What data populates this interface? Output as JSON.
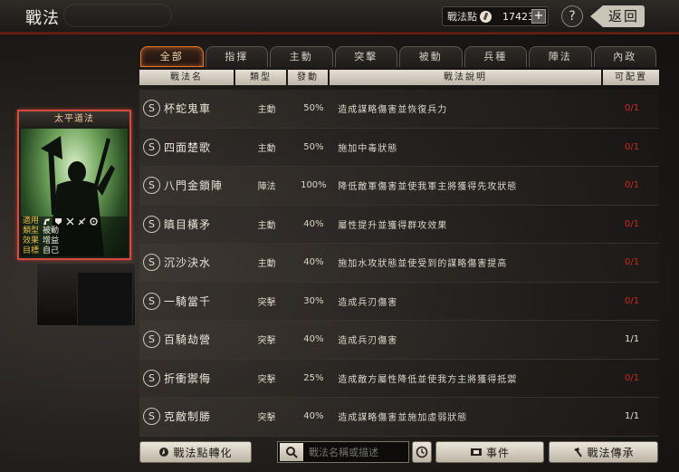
{
  "header": {
    "title": "戰法",
    "points_label": "戰法點",
    "points_value": "17423",
    "plus": "+",
    "help": "?",
    "back": "返回"
  },
  "tabs": [
    {
      "label": "全部",
      "active": true
    },
    {
      "label": "指揮",
      "active": false
    },
    {
      "label": "主動",
      "active": false
    },
    {
      "label": "突擊",
      "active": false
    },
    {
      "label": "被動",
      "active": false
    },
    {
      "label": "兵種",
      "active": false
    },
    {
      "label": "陣法",
      "active": false
    },
    {
      "label": "內政",
      "active": false
    }
  ],
  "table": {
    "headers": {
      "name": "戰法名",
      "type": "類型",
      "rate": "發動",
      "desc": "戰法說明",
      "cfg": "可配置"
    },
    "rows": [
      {
        "badge": "S",
        "name": "杯蛇鬼車",
        "type": "主動",
        "rate": "50%",
        "desc": "造成謀略傷害並恢復兵力",
        "cfg": "0/1",
        "cfg_color": "red"
      },
      {
        "badge": "S",
        "name": "四面楚歌",
        "type": "主動",
        "rate": "50%",
        "desc": "施加中毒狀態",
        "cfg": "0/1",
        "cfg_color": "red"
      },
      {
        "badge": "S",
        "name": "八門金鎖陣",
        "type": "陣法",
        "rate": "100%",
        "desc": "降低敵軍傷害並使我軍主將獲得先攻狀態",
        "cfg": "0/1",
        "cfg_color": "red"
      },
      {
        "badge": "S",
        "name": "瞋目橫矛",
        "type": "主動",
        "rate": "40%",
        "desc": "屬性提升並獲得群攻效果",
        "cfg": "0/1",
        "cfg_color": "red"
      },
      {
        "badge": "S",
        "name": "沉沙決水",
        "type": "主動",
        "rate": "40%",
        "desc": "施加水攻狀態並使受到的謀略傷害提高",
        "cfg": "0/1",
        "cfg_color": "red"
      },
      {
        "badge": "S",
        "name": "一騎當千",
        "type": "突擊",
        "rate": "30%",
        "desc": "造成兵刃傷害",
        "cfg": "0/1",
        "cfg_color": "red"
      },
      {
        "badge": "S",
        "name": "百騎劫營",
        "type": "突擊",
        "rate": "40%",
        "desc": "造成兵刃傷害",
        "cfg": "1/1",
        "cfg_color": "white"
      },
      {
        "badge": "S",
        "name": "折衝禦侮",
        "type": "突擊",
        "rate": "25%",
        "desc": "造成敵方屬性降低並使我方主將獲得抵禦",
        "cfg": "0/1",
        "cfg_color": "red"
      },
      {
        "badge": "S",
        "name": "克敵制勝",
        "type": "突擊",
        "rate": "40%",
        "desc": "造成謀略傷害並施加虛弱狀態",
        "cfg": "1/1",
        "cfg_color": "white"
      }
    ]
  },
  "card": {
    "title": "太平道法",
    "info": [
      {
        "key": "適用",
        "value": ""
      },
      {
        "key": "類型",
        "value": "被動"
      },
      {
        "key": "效果",
        "value": "增益"
      },
      {
        "key": "目標",
        "value": "自己"
      }
    ],
    "icons": [
      "horse-icon",
      "shield-icon",
      "crossed-swords-icon",
      "bow-icon",
      "gear-icon"
    ]
  },
  "bottom": {
    "convert_label": "戰法點轉化",
    "search_placeholder": "戰法名稱或描述",
    "event_label": "事件",
    "inherit_label": "戰法傳承"
  },
  "colors": {
    "accent": "#e0762c",
    "config_red": "#c8281e",
    "card_border": "#d54b3e"
  }
}
